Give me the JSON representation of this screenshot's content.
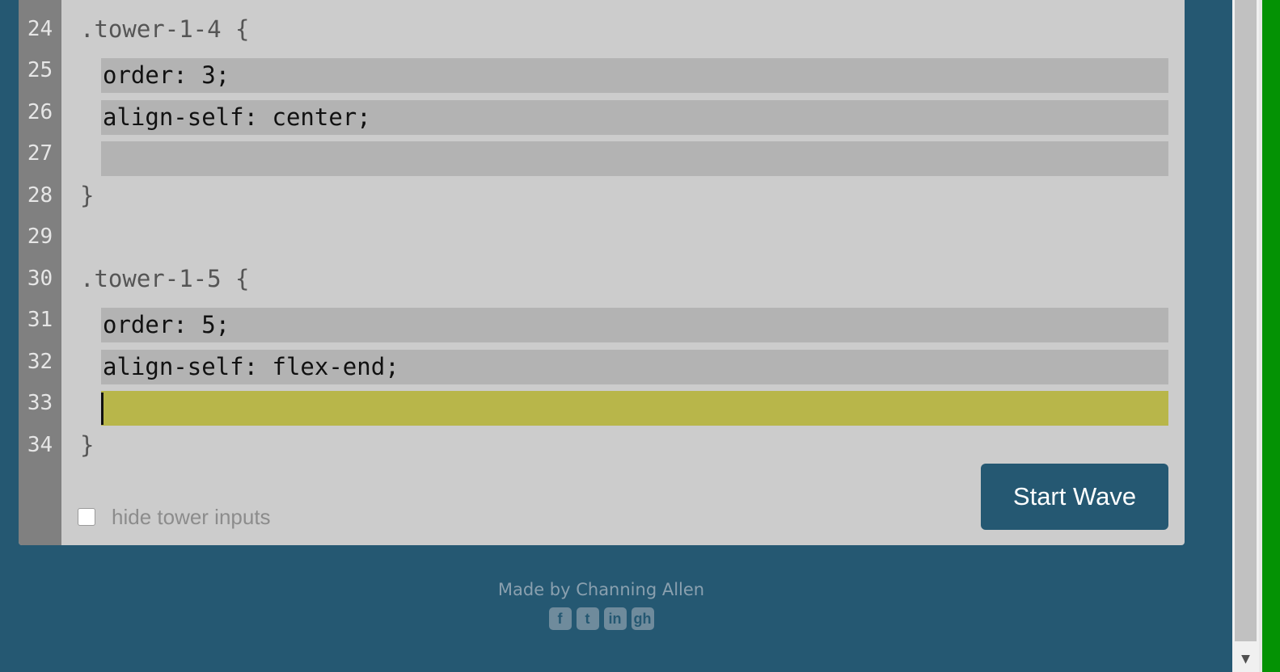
{
  "editor": {
    "lines": [
      {
        "number": "24",
        "text": ".tower-1-4 {"
      },
      {
        "number": "25",
        "input": "order: 3;"
      },
      {
        "number": "26",
        "input": "align-self: center;"
      },
      {
        "number": "27",
        "input": ""
      },
      {
        "number": "28",
        "text": "}"
      },
      {
        "number": "29",
        "text": ""
      },
      {
        "number": "30",
        "text": ".tower-1-5 {"
      },
      {
        "number": "31",
        "input": "order: 5;"
      },
      {
        "number": "32",
        "input": "align-self: flex-end;"
      },
      {
        "number": "33",
        "input": ""
      },
      {
        "number": "34",
        "text": "}"
      }
    ]
  },
  "controls": {
    "hide_inputs_label": "hide tower inputs",
    "hide_inputs_checked": false,
    "start_button": "Start Wave"
  },
  "footer": {
    "made_by": "Made by Channing Allen",
    "socials": [
      {
        "icon": "facebook-icon",
        "glyph": "f"
      },
      {
        "icon": "twitter-icon",
        "glyph": "t"
      },
      {
        "icon": "linkedin-icon",
        "glyph": "in"
      },
      {
        "icon": "github-icon",
        "glyph": "gh"
      }
    ]
  },
  "colors": {
    "background": "#255872",
    "editor": "#cccccc",
    "gutter": "#808080",
    "input": "#b3b3b3",
    "active_input": "#b8b64a"
  }
}
